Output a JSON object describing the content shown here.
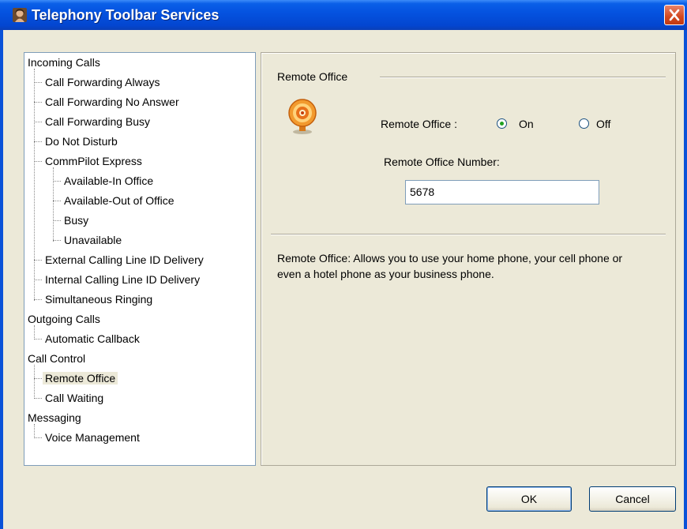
{
  "window": {
    "title": "Telephony Toolbar Services",
    "close_symbol": "✕"
  },
  "tree": {
    "items": [
      {
        "label": "Incoming Calls"
      },
      {
        "label": "Call Forwarding Always"
      },
      {
        "label": "Call Forwarding No Answer"
      },
      {
        "label": "Call Forwarding Busy"
      },
      {
        "label": "Do Not Disturb"
      },
      {
        "label": "CommPilot Express"
      },
      {
        "label": "Available-In Office"
      },
      {
        "label": "Available-Out of Office"
      },
      {
        "label": "Busy"
      },
      {
        "label": "Unavailable"
      },
      {
        "label": "External Calling Line ID Delivery"
      },
      {
        "label": "Internal Calling Line ID Delivery"
      },
      {
        "label": "Simultaneous Ringing"
      },
      {
        "label": "Outgoing Calls"
      },
      {
        "label": "Automatic Callback"
      },
      {
        "label": "Call Control"
      },
      {
        "label": "Remote Office"
      },
      {
        "label": "Call Waiting"
      },
      {
        "label": "Messaging"
      },
      {
        "label": "Voice Management"
      }
    ],
    "selected": "Remote Office"
  },
  "panel": {
    "group_title": "Remote Office",
    "icon": "remote-office-target-icon",
    "remote_office_label": "Remote Office :",
    "on_label": "On",
    "off_label": "Off",
    "selected_option": "On",
    "number_label": "Remote Office Number:",
    "number_value": "5678",
    "description": "Remote Office: Allows you to use your home phone, your cell phone or even a hotel phone as your business phone."
  },
  "buttons": {
    "ok": "OK",
    "cancel": "Cancel"
  },
  "colors": {
    "titlebar": "#0553e0",
    "face": "#ece9d8",
    "close": "#d2481f"
  }
}
